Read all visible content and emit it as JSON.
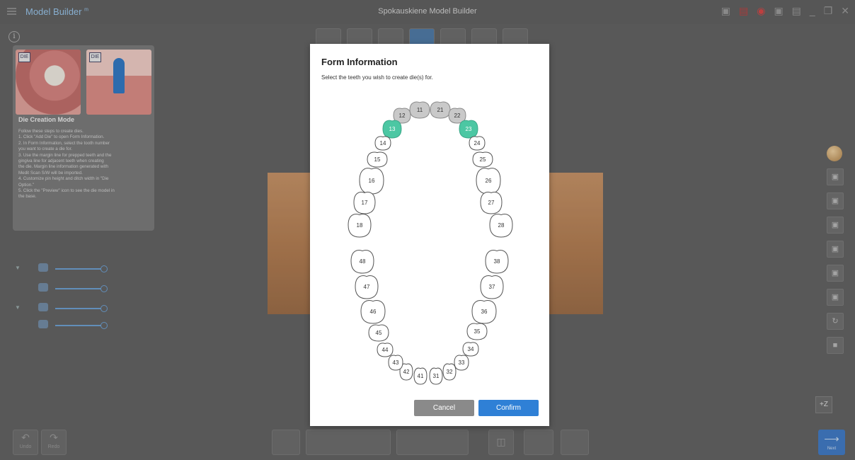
{
  "app": {
    "title": "Model Builder",
    "title_sup": "m",
    "window_title": "Spokauskiene Model Builder"
  },
  "help": {
    "heading": "Die Creation Mode",
    "badge_a": "DIE",
    "badge_b": "DIE",
    "lines": [
      "Follow these steps to create dies.",
      "1. Click \"Add Die\" to open Form Information.",
      "2. In Form Information, select the tooth number",
      "you want to create a die for.",
      "3. Use the margin line for prepped teeth and the",
      "gingiva line for adjacent teeth when creating",
      "the die. Margin line information generated with",
      "Medit Scan S/W will be imported.",
      "4. Customize pin height and ditch width in \"Die",
      "Option.\"",
      "5. Click the \"Preview\" icon to see the die model in",
      "the base."
    ]
  },
  "controls": {
    "z_button": "+Z",
    "undo_label": "Undo",
    "redo_label": "Redo",
    "next_label": "Next"
  },
  "dialog": {
    "title": "Form Information",
    "subtitle": "Select the teeth you wish to create die(s) for.",
    "cancel": "Cancel",
    "confirm": "Confirm"
  },
  "colors": {
    "selected_tooth": "#4cc7a3",
    "disabled_tooth": "#c9c9c9",
    "accent": "#2f80d6"
  },
  "teeth": [
    {
      "number": "11",
      "state": "disabled"
    },
    {
      "number": "12",
      "state": "disabled"
    },
    {
      "number": "13",
      "state": "selected"
    },
    {
      "number": "14",
      "state": "normal"
    },
    {
      "number": "15",
      "state": "normal"
    },
    {
      "number": "16",
      "state": "normal"
    },
    {
      "number": "17",
      "state": "normal"
    },
    {
      "number": "18",
      "state": "normal"
    },
    {
      "number": "21",
      "state": "disabled"
    },
    {
      "number": "22",
      "state": "disabled"
    },
    {
      "number": "23",
      "state": "selected"
    },
    {
      "number": "24",
      "state": "normal"
    },
    {
      "number": "25",
      "state": "normal"
    },
    {
      "number": "26",
      "state": "normal"
    },
    {
      "number": "27",
      "state": "normal"
    },
    {
      "number": "28",
      "state": "normal"
    },
    {
      "number": "31",
      "state": "normal"
    },
    {
      "number": "32",
      "state": "normal"
    },
    {
      "number": "33",
      "state": "normal"
    },
    {
      "number": "34",
      "state": "normal"
    },
    {
      "number": "35",
      "state": "normal"
    },
    {
      "number": "36",
      "state": "normal"
    },
    {
      "number": "37",
      "state": "normal"
    },
    {
      "number": "38",
      "state": "normal"
    },
    {
      "number": "41",
      "state": "normal"
    },
    {
      "number": "42",
      "state": "normal"
    },
    {
      "number": "43",
      "state": "normal"
    },
    {
      "number": "44",
      "state": "normal"
    },
    {
      "number": "45",
      "state": "normal"
    },
    {
      "number": "46",
      "state": "normal"
    },
    {
      "number": "47",
      "state": "normal"
    },
    {
      "number": "48",
      "state": "normal"
    }
  ]
}
